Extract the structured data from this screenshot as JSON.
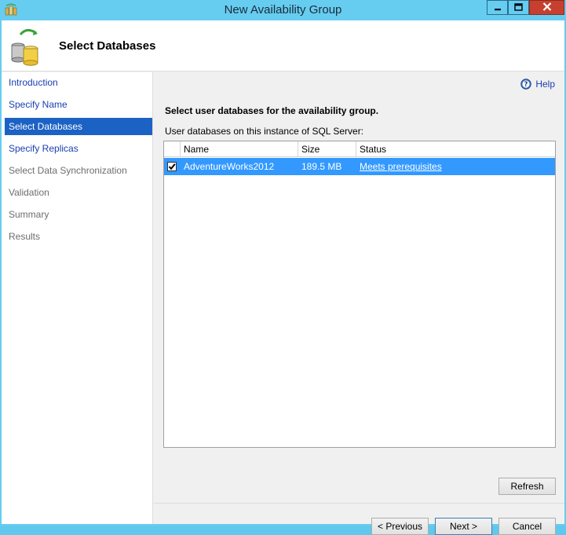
{
  "window": {
    "title": "New Availability Group",
    "minimize_icon": "minimize-icon",
    "maximize_icon": "maximize-icon",
    "close_icon": "close-icon"
  },
  "header": {
    "title": "Select Databases",
    "icon": "database-sync-icon"
  },
  "sidebar": {
    "items": [
      {
        "label": "Introduction",
        "state": "link"
      },
      {
        "label": "Specify Name",
        "state": "link"
      },
      {
        "label": "Select Databases",
        "state": "active"
      },
      {
        "label": "Specify Replicas",
        "state": "link"
      },
      {
        "label": "Select Data Synchronization",
        "state": "disabled"
      },
      {
        "label": "Validation",
        "state": "disabled"
      },
      {
        "label": "Summary",
        "state": "disabled"
      },
      {
        "label": "Results",
        "state": "disabled"
      }
    ]
  },
  "main": {
    "help_label": "Help",
    "help_icon": "help-icon",
    "section_title": "Select user databases for the availability group.",
    "list_label": "User databases on this instance of SQL Server:",
    "columns": [
      "Name",
      "Size",
      "Status"
    ],
    "rows": [
      {
        "checked": true,
        "name": "AdventureWorks2012",
        "size": "189.5 MB",
        "status": "Meets prerequisites"
      }
    ],
    "refresh_label": "Refresh"
  },
  "footer": {
    "previous_label": "< Previous",
    "next_label": "Next >",
    "cancel_label": "Cancel"
  },
  "colors": {
    "title_bar": "#66cdf0",
    "selection": "#3399ff",
    "active_nav": "#1c62c4",
    "link": "#1a3fb0",
    "close_button": "#c7402f"
  }
}
